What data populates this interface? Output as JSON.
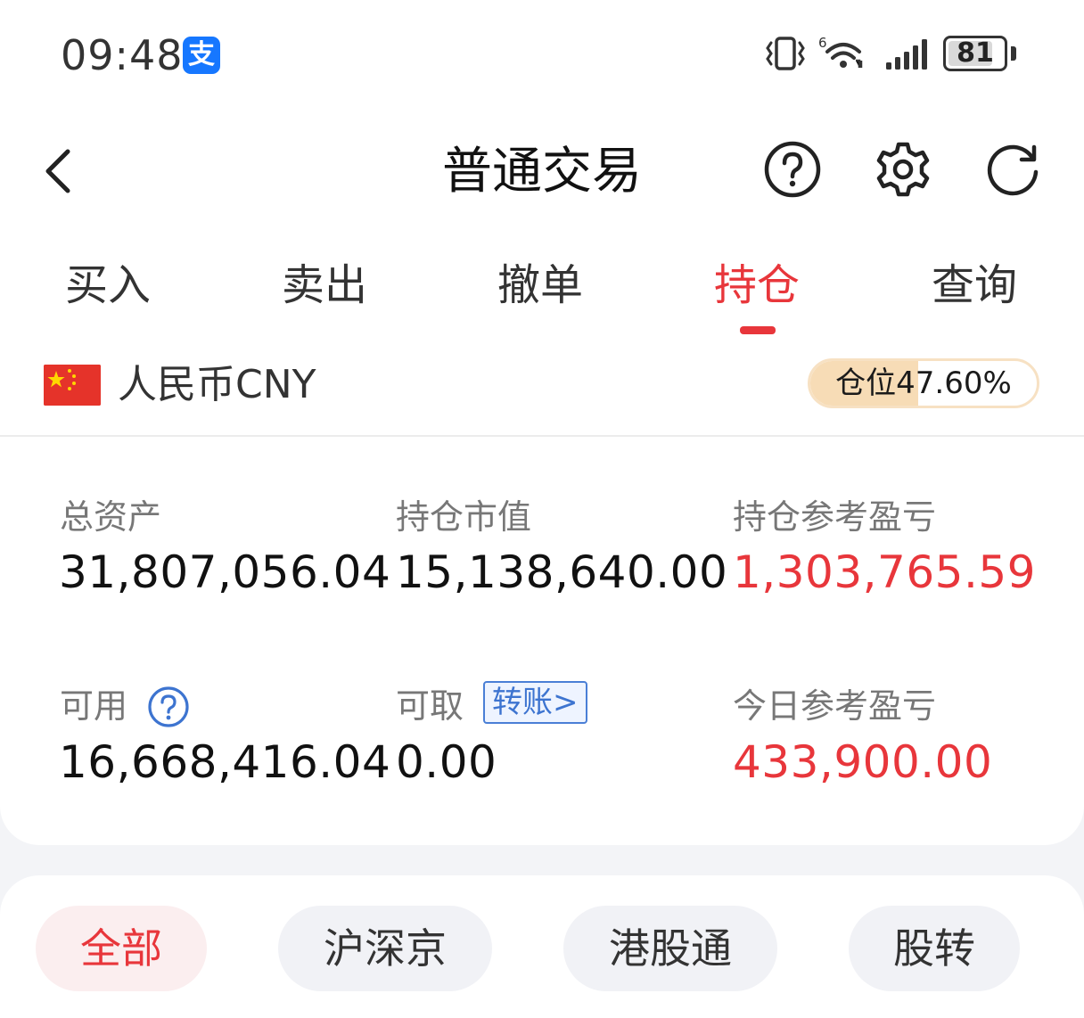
{
  "status_bar": {
    "time": "09:48",
    "app_icon": "alipay-icon",
    "wifi_superscript": "6",
    "battery_level": "81",
    "battery_fraction": 0.81
  },
  "header": {
    "title": "普通交易",
    "icons": [
      "back-icon",
      "help-icon",
      "gear-icon",
      "refresh-icon"
    ]
  },
  "tabs": [
    {
      "label": "买入"
    },
    {
      "label": "卖出"
    },
    {
      "label": "撤单"
    },
    {
      "label": "持仓"
    },
    {
      "label": "查询"
    }
  ],
  "active_tab_index": 3,
  "currency": {
    "label": "人民币CNY",
    "flag": "china-flag-icon",
    "position_label": "仓位47.60%",
    "position_ratio": 0.476
  },
  "assets": {
    "total_label": "总资产",
    "total_value": "31,807,056.04",
    "market_value_label": "持仓市值",
    "market_value": "15,138,640.00",
    "position_pnl_label": "持仓参考盈亏",
    "position_pnl": "1,303,765.59",
    "available_label": "可用",
    "available_value": "16,668,416.04",
    "withdrawable_label": "可取",
    "transfer_label": "转账>",
    "withdrawable_value": "0.00",
    "today_pnl_label": "今日参考盈亏",
    "today_pnl": "433,900.00"
  },
  "filters": [
    {
      "label": "全部"
    },
    {
      "label": "沪深京"
    },
    {
      "label": "港股通"
    },
    {
      "label": "股转"
    }
  ],
  "active_filter_index": 0,
  "colors": {
    "accent_red": "#e8363b",
    "link_blue": "#3d74d0",
    "position_fill": "#f7dcb6",
    "page_bg": "#f3f4f7"
  }
}
